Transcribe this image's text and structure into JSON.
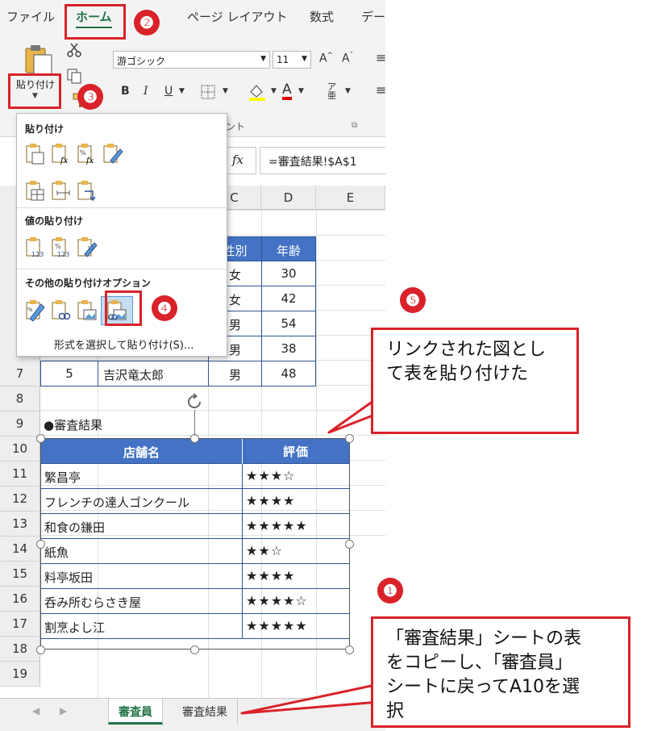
{
  "ribbon_tabs": [
    "ファイル",
    "ホーム",
    "ページ レイアウト",
    "数式",
    "デー"
  ],
  "ribbon": {
    "font_name": "游ゴシック",
    "font_size": "11",
    "grow_font": "A",
    "shrink_font": "A",
    "paste_label": "貼り付け",
    "bold": "B",
    "italic": "I",
    "underline": "U",
    "font_color_letter": "A",
    "group_label_font_tail": "ント"
  },
  "formula_bar": {
    "fx": "fx",
    "content": "=審査結果!$A$1"
  },
  "paste_menu": {
    "section_paste": "貼り付け",
    "section_values": "値の貼り付け",
    "section_other": "その他の貼り付けオプション",
    "special": "形式を選択して貼り付け(S)..."
  },
  "column_headers": [
    "C",
    "D",
    "E"
  ],
  "row_headers": [
    "7",
    "8",
    "9",
    "10",
    "11",
    "12",
    "13",
    "14",
    "15",
    "16",
    "17",
    "18",
    "19"
  ],
  "table": {
    "header_gender": "性別",
    "header_age": "年齢",
    "rows": [
      {
        "gender": "女",
        "age": "30"
      },
      {
        "gender": "女",
        "age": "42"
      },
      {
        "gender": "男",
        "age": "54"
      },
      {
        "gender": "男",
        "age": "38"
      }
    ],
    "row7": {
      "no": "5",
      "name": "吉沢竜太郎",
      "gender": "男",
      "age": "48"
    }
  },
  "section_title": "●審査結果",
  "linked_picture": {
    "header_name": "店舗名",
    "header_rating": "評価",
    "rows": [
      {
        "name": "繁昌亭",
        "rating": "★★★☆"
      },
      {
        "name": "フレンチの達人ゴンクール",
        "rating": "★★★★"
      },
      {
        "name": "和食の鎌田",
        "rating": "★★★★★"
      },
      {
        "name": "紙魚",
        "rating": "★★☆"
      },
      {
        "name": "料亭坂田",
        "rating": "★★★★"
      },
      {
        "name": "呑み所むらさき屋",
        "rating": "★★★★☆"
      },
      {
        "name": "割烹よし江",
        "rating": "★★★★★"
      }
    ]
  },
  "sheet_tabs": [
    "審査員",
    "審査結果"
  ],
  "badges": [
    "❶",
    "❷",
    "❸",
    "❹",
    "❺"
  ],
  "callouts": {
    "top": "リンクされた図とし\nて表を貼り付けた",
    "bottom": "「審査結果」シートの表\nをコピーし、「審査員」\nシートに戻ってA10を選\n択"
  },
  "colors": {
    "accent_red": "#d9222a",
    "table_header_blue": "#4472c4",
    "excel_green": "#217346"
  }
}
